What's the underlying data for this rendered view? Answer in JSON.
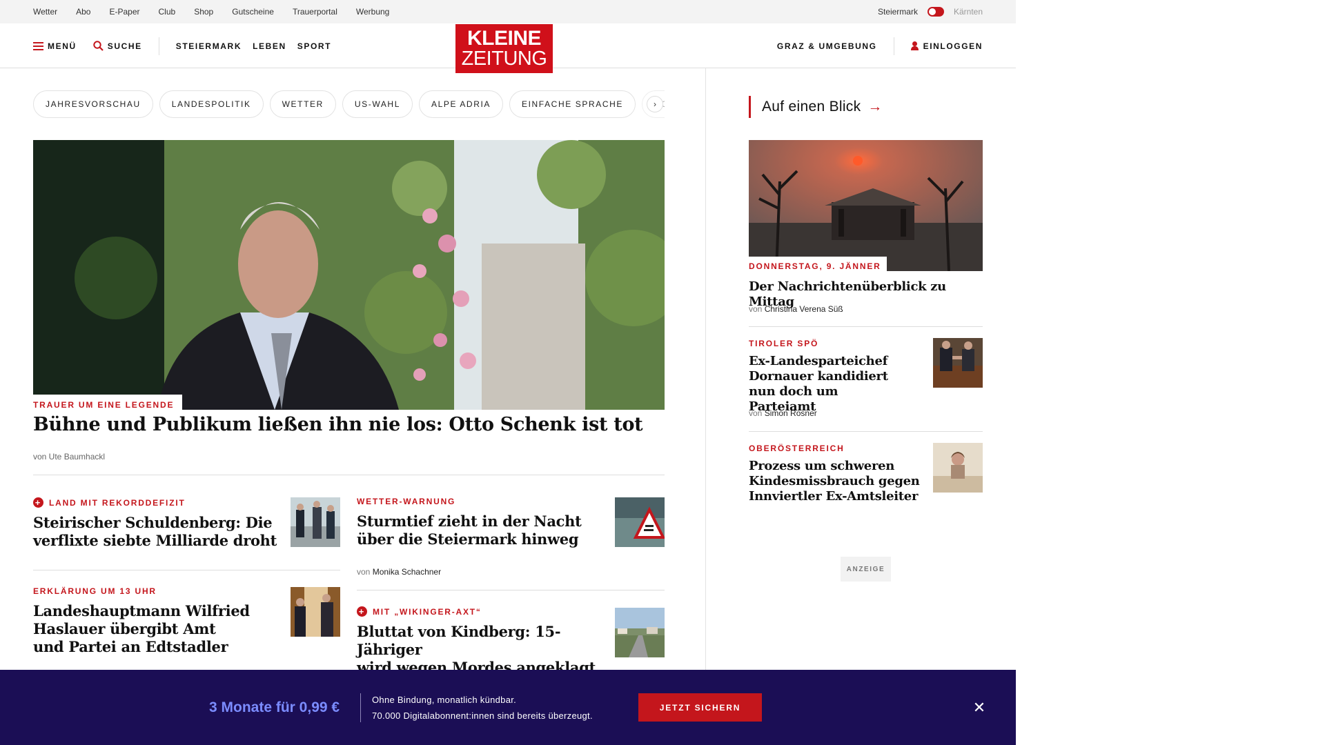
{
  "topbar": {
    "links": [
      "Wetter",
      "Abo",
      "E-Paper",
      "Club",
      "Shop",
      "Gutscheine",
      "Trauerportal",
      "Werbung"
    ],
    "region_left": "Steiermark",
    "region_right": "Kärnten"
  },
  "header": {
    "menu_label": "MENÜ",
    "search_label": "SUCHE",
    "nav": [
      "STEIERMARK",
      "LEBEN",
      "SPORT"
    ],
    "logo_line1": "KLEINE",
    "logo_line2": "ZEITUNG",
    "region_label": "GRAZ & UMGEBUNG",
    "login_label": "EINLOGGEN"
  },
  "chips": [
    "JAHRESVORSCHAU",
    "LANDESPOLITIK",
    "WETTER",
    "US-WAHL",
    "ALPE ADRIA",
    "EINFACHE SPRACHE",
    "DOS"
  ],
  "chip_next": "›",
  "hero": {
    "kicker": "TRAUER UM EINE LEGENDE",
    "title": "Bühne und Publikum ließen ihn nie los: Otto Schenk ist tot",
    "author": "von Ute Baumhackl"
  },
  "articles": [
    {
      "kicker": "LAND MIT REKORDDEFIZIT",
      "premium": true,
      "title_line1": "Steirischer Schuldenberg: Die",
      "title_line2": "verflixte siebte Milliarde droht"
    },
    {
      "kicker": "WETTER-WARNUNG",
      "premium": false,
      "title_line1": "Sturmtief zieht in der Nacht",
      "title_line2": "über die Steiermark hinweg",
      "author_prefix": "von",
      "author": "Monika Schachner"
    },
    {
      "kicker": "ERKLÄRUNG UM 13 UHR",
      "premium": false,
      "title_line1": "Landeshauptmann Wilfried",
      "title_line2": "Haslauer übergibt Amt",
      "title_line3": "und Partei an Edtstadler"
    },
    {
      "kicker": "MIT „WIKINGER-AXT“",
      "premium": true,
      "title_line1": "Bluttat von Kindberg: 15-Jähriger",
      "title_line2": "wird wegen Mordes angeklagt"
    }
  ],
  "sidebar": {
    "heading": "Auf einen Blick",
    "heading_arrow": "→",
    "items": [
      {
        "kicker": "DONNERSTAG, 9. JÄNNER",
        "title": "Der Nachrichtenüberblick zu Mittag",
        "author_prefix": "von",
        "author": "Christina Verena Süß"
      },
      {
        "kicker": "TIROLER SPÖ",
        "title_line1": "Ex-Landesparteichef",
        "title_line2": "Dornauer kandidiert",
        "title_line3": "nun doch um Parteiamt",
        "author_prefix": "von",
        "author": "Simon Rosner"
      },
      {
        "kicker": "OBERÖSTERREICH",
        "title_line1": "Prozess um schweren",
        "title_line2": "Kindesmissbrauch gegen",
        "title_line3": "Innviertler Ex-Amtsleiter"
      }
    ],
    "ad_label": "ANZEIGE"
  },
  "promo": {
    "price": "3 Monate für 0,99 €",
    "line1": "Ohne Bindung, monatlich kündbar.",
    "line2": "70.000 Digitalabonnent:innen sind bereits überzeugt.",
    "cta": "JETZT SICHERN",
    "close": "✕"
  },
  "colors": {
    "brand_red": "#c4161c",
    "promo_bg": "#1b0e55",
    "promo_price": "#7b8cff"
  }
}
